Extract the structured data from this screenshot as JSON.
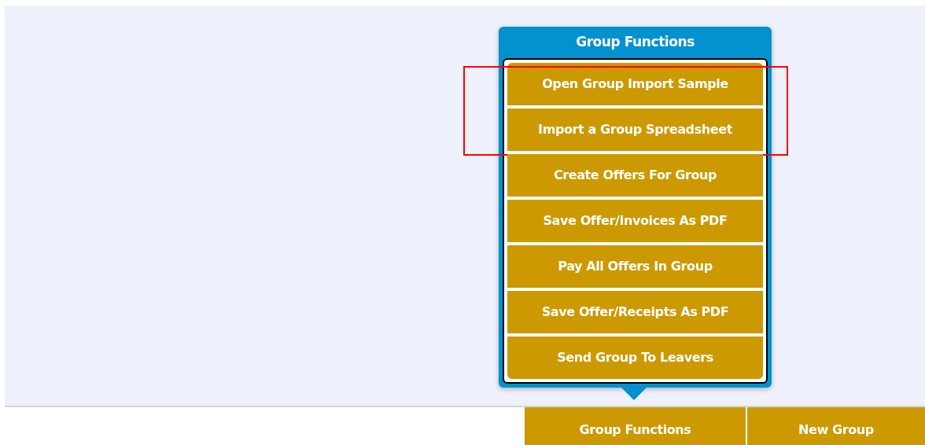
{
  "popup": {
    "title": "Group Functions",
    "items": [
      {
        "label": "Open Group Import Sample",
        "highlighted": true
      },
      {
        "label": "Import a Group Spreadsheet",
        "highlighted": true
      },
      {
        "label": "Create Offers For Group",
        "highlighted": false
      },
      {
        "label": "Save Offer/Invoices As PDF",
        "highlighted": false
      },
      {
        "label": "Pay All Offers In Group",
        "highlighted": false
      },
      {
        "label": "Save Offer/Receipts As PDF",
        "highlighted": false
      },
      {
        "label": "Send Group To Leavers",
        "highlighted": false
      }
    ]
  },
  "bottom_buttons": [
    {
      "label": "Group Functions"
    },
    {
      "label": "New Group"
    }
  ]
}
